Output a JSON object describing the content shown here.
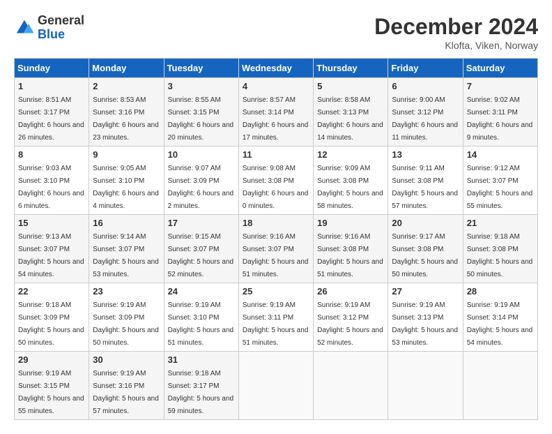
{
  "header": {
    "logo_general": "General",
    "logo_blue": "Blue",
    "title": "December 2024",
    "location": "Klofta, Viken, Norway"
  },
  "weekdays": [
    "Sunday",
    "Monday",
    "Tuesday",
    "Wednesday",
    "Thursday",
    "Friday",
    "Saturday"
  ],
  "weeks": [
    [
      {
        "day": "1",
        "sunrise": "8:51 AM",
        "sunset": "3:17 PM",
        "daylight": "6 hours and 26 minutes."
      },
      {
        "day": "2",
        "sunrise": "8:53 AM",
        "sunset": "3:16 PM",
        "daylight": "6 hours and 23 minutes."
      },
      {
        "day": "3",
        "sunrise": "8:55 AM",
        "sunset": "3:15 PM",
        "daylight": "6 hours and 20 minutes."
      },
      {
        "day": "4",
        "sunrise": "8:57 AM",
        "sunset": "3:14 PM",
        "daylight": "6 hours and 17 minutes."
      },
      {
        "day": "5",
        "sunrise": "8:58 AM",
        "sunset": "3:13 PM",
        "daylight": "6 hours and 14 minutes."
      },
      {
        "day": "6",
        "sunrise": "9:00 AM",
        "sunset": "3:12 PM",
        "daylight": "6 hours and 11 minutes."
      },
      {
        "day": "7",
        "sunrise": "9:02 AM",
        "sunset": "3:11 PM",
        "daylight": "6 hours and 9 minutes."
      }
    ],
    [
      {
        "day": "8",
        "sunrise": "9:03 AM",
        "sunset": "3:10 PM",
        "daylight": "6 hours and 6 minutes."
      },
      {
        "day": "9",
        "sunrise": "9:05 AM",
        "sunset": "3:10 PM",
        "daylight": "6 hours and 4 minutes."
      },
      {
        "day": "10",
        "sunrise": "9:07 AM",
        "sunset": "3:09 PM",
        "daylight": "6 hours and 2 minutes."
      },
      {
        "day": "11",
        "sunrise": "9:08 AM",
        "sunset": "3:08 PM",
        "daylight": "6 hours and 0 minutes."
      },
      {
        "day": "12",
        "sunrise": "9:09 AM",
        "sunset": "3:08 PM",
        "daylight": "5 hours and 58 minutes."
      },
      {
        "day": "13",
        "sunrise": "9:11 AM",
        "sunset": "3:08 PM",
        "daylight": "5 hours and 57 minutes."
      },
      {
        "day": "14",
        "sunrise": "9:12 AM",
        "sunset": "3:07 PM",
        "daylight": "5 hours and 55 minutes."
      }
    ],
    [
      {
        "day": "15",
        "sunrise": "9:13 AM",
        "sunset": "3:07 PM",
        "daylight": "5 hours and 54 minutes."
      },
      {
        "day": "16",
        "sunrise": "9:14 AM",
        "sunset": "3:07 PM",
        "daylight": "5 hours and 53 minutes."
      },
      {
        "day": "17",
        "sunrise": "9:15 AM",
        "sunset": "3:07 PM",
        "daylight": "5 hours and 52 minutes."
      },
      {
        "day": "18",
        "sunrise": "9:16 AM",
        "sunset": "3:07 PM",
        "daylight": "5 hours and 51 minutes."
      },
      {
        "day": "19",
        "sunrise": "9:16 AM",
        "sunset": "3:08 PM",
        "daylight": "5 hours and 51 minutes."
      },
      {
        "day": "20",
        "sunrise": "9:17 AM",
        "sunset": "3:08 PM",
        "daylight": "5 hours and 50 minutes."
      },
      {
        "day": "21",
        "sunrise": "9:18 AM",
        "sunset": "3:08 PM",
        "daylight": "5 hours and 50 minutes."
      }
    ],
    [
      {
        "day": "22",
        "sunrise": "9:18 AM",
        "sunset": "3:09 PM",
        "daylight": "5 hours and 50 minutes."
      },
      {
        "day": "23",
        "sunrise": "9:19 AM",
        "sunset": "3:09 PM",
        "daylight": "5 hours and 50 minutes."
      },
      {
        "day": "24",
        "sunrise": "9:19 AM",
        "sunset": "3:10 PM",
        "daylight": "5 hours and 51 minutes."
      },
      {
        "day": "25",
        "sunrise": "9:19 AM",
        "sunset": "3:11 PM",
        "daylight": "5 hours and 51 minutes."
      },
      {
        "day": "26",
        "sunrise": "9:19 AM",
        "sunset": "3:12 PM",
        "daylight": "5 hours and 52 minutes."
      },
      {
        "day": "27",
        "sunrise": "9:19 AM",
        "sunset": "3:13 PM",
        "daylight": "5 hours and 53 minutes."
      },
      {
        "day": "28",
        "sunrise": "9:19 AM",
        "sunset": "3:14 PM",
        "daylight": "5 hours and 54 minutes."
      }
    ],
    [
      {
        "day": "29",
        "sunrise": "9:19 AM",
        "sunset": "3:15 PM",
        "daylight": "5 hours and 55 minutes."
      },
      {
        "day": "30",
        "sunrise": "9:19 AM",
        "sunset": "3:16 PM",
        "daylight": "5 hours and 57 minutes."
      },
      {
        "day": "31",
        "sunrise": "9:18 AM",
        "sunset": "3:17 PM",
        "daylight": "5 hours and 59 minutes."
      },
      null,
      null,
      null,
      null
    ]
  ]
}
